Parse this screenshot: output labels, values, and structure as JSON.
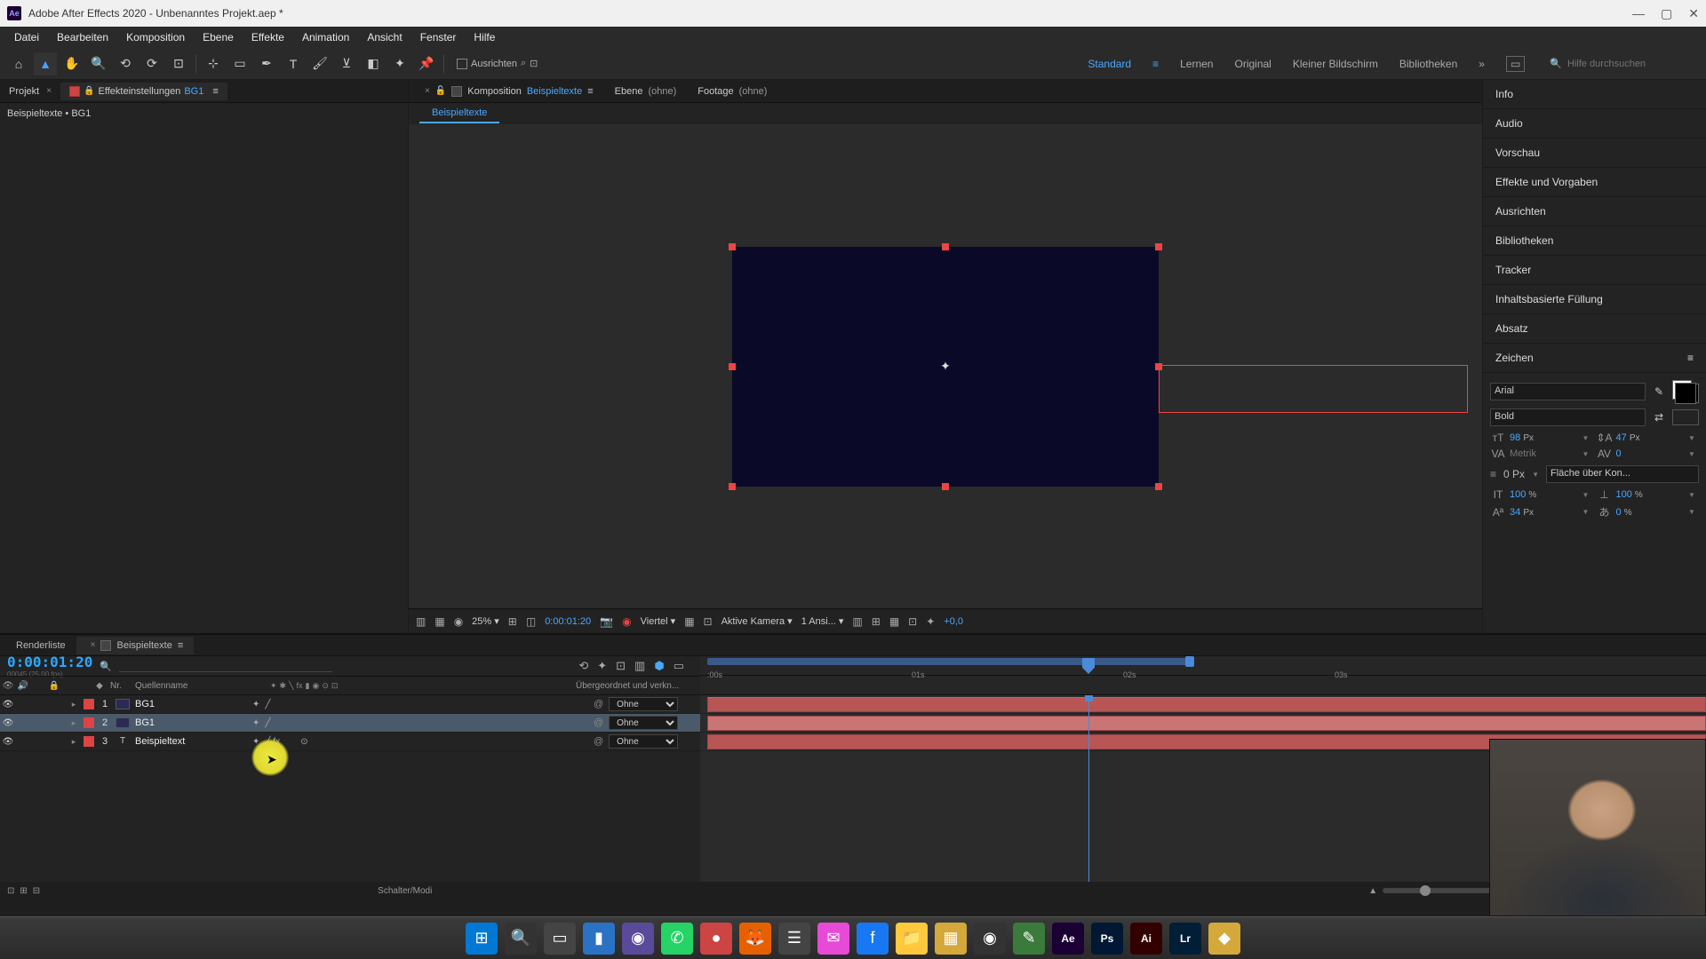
{
  "window": {
    "app": "Adobe After Effects 2020",
    "project": "Unbenanntes Projekt.aep *"
  },
  "menu": [
    "Datei",
    "Bearbeiten",
    "Komposition",
    "Ebene",
    "Effekte",
    "Animation",
    "Ansicht",
    "Fenster",
    "Hilfe"
  ],
  "toolbar": {
    "align_label": "Ausrichten",
    "search_placeholder": "Hilfe durchsuchen"
  },
  "workspaces": [
    "Standard",
    "Lernen",
    "Original",
    "Kleiner Bildschirm",
    "Bibliotheken"
  ],
  "left": {
    "project_tab": "Projekt",
    "effects_tab": "Effekteinstellungen",
    "effects_target": "BG1",
    "breadcrumb": "Beispieltexte • BG1"
  },
  "comp": {
    "label": "Komposition",
    "name": "Beispieltexte",
    "layer_tab": "Ebene",
    "layer_none": "(ohne)",
    "footage_tab": "Footage",
    "footage_none": "(ohne)",
    "subtab": "Beispieltexte"
  },
  "viewport": {
    "zoom": "25%",
    "timecode": "0:00:01:20",
    "quality": "Viertel",
    "camera": "Aktive Kamera",
    "views": "1 Ansi...",
    "exposure": "+0,0"
  },
  "right": {
    "panels": [
      "Info",
      "Audio",
      "Vorschau",
      "Effekte und Vorgaben",
      "Ausrichten",
      "Bibliotheken",
      "Tracker",
      "Inhaltsbasierte Füllung",
      "Absatz"
    ],
    "char_title": "Zeichen",
    "font": "Arial",
    "weight": "Bold",
    "size": "98",
    "size_u": "Px",
    "leading": "47",
    "leading_u": "Px",
    "kerning": "Metrik",
    "tracking": "0",
    "stroke": "0",
    "stroke_u": "Px",
    "stroke_opt": "Fläche über Kon...",
    "scale_h": "100",
    "scale_h_u": "%",
    "scale_v": "100",
    "scale_v_u": "%",
    "baseline": "34",
    "baseline_u": "Px",
    "tsume": "0",
    "tsume_u": "%"
  },
  "timeline": {
    "render_tab": "Renderliste",
    "comp_tab": "Beispieltexte",
    "timecode": "0:00:01:20",
    "timecode_sub": "00045 (25.00 fps)",
    "cols": {
      "nr": "Nr.",
      "source": "Quellenname",
      "parent": "Übergeordnet und verkn..."
    },
    "ticks": [
      ":00s",
      "01s",
      "02s",
      "03s"
    ],
    "layers": [
      {
        "num": "1",
        "name": "BG1",
        "parent": "Ohne",
        "type": "solid"
      },
      {
        "num": "2",
        "name": "BG1",
        "parent": "Ohne",
        "type": "solid",
        "selected": true
      },
      {
        "num": "3",
        "name": "Beispieltext",
        "parent": "Ohne",
        "type": "text"
      }
    ],
    "footer": "Schalter/Modi"
  },
  "taskbar": [
    {
      "n": "start",
      "bg": "#0078d4",
      "t": "⊞"
    },
    {
      "n": "search",
      "bg": "#333",
      "t": "🔍"
    },
    {
      "n": "taskview",
      "bg": "#444",
      "t": "▭"
    },
    {
      "n": "explorer",
      "bg": "#2a72c4",
      "t": "▮"
    },
    {
      "n": "app1",
      "bg": "#5a4a9a",
      "t": "◉"
    },
    {
      "n": "whatsapp",
      "bg": "#25d366",
      "t": "✆"
    },
    {
      "n": "app2",
      "bg": "#c44",
      "t": "●"
    },
    {
      "n": "firefox",
      "bg": "#e66000",
      "t": "🦊"
    },
    {
      "n": "app3",
      "bg": "#444",
      "t": "☰"
    },
    {
      "n": "messenger",
      "bg": "#e84ad8",
      "t": "✉"
    },
    {
      "n": "facebook",
      "bg": "#1877f2",
      "t": "f"
    },
    {
      "n": "folder",
      "bg": "#ffc83d",
      "t": "📁"
    },
    {
      "n": "app4",
      "bg": "#d4a83a",
      "t": "▦"
    },
    {
      "n": "obs",
      "bg": "#333",
      "t": "◉"
    },
    {
      "n": "notes",
      "bg": "#3a7a3a",
      "t": "✎"
    },
    {
      "n": "ae",
      "bg": "#1a0033",
      "t": "Ae"
    },
    {
      "n": "ps",
      "bg": "#001833",
      "t": "Ps"
    },
    {
      "n": "ai",
      "bg": "#330000",
      "t": "Ai"
    },
    {
      "n": "lr",
      "bg": "#001e36",
      "t": "Lr"
    },
    {
      "n": "app5",
      "bg": "#d4a83a",
      "t": "◆"
    }
  ]
}
